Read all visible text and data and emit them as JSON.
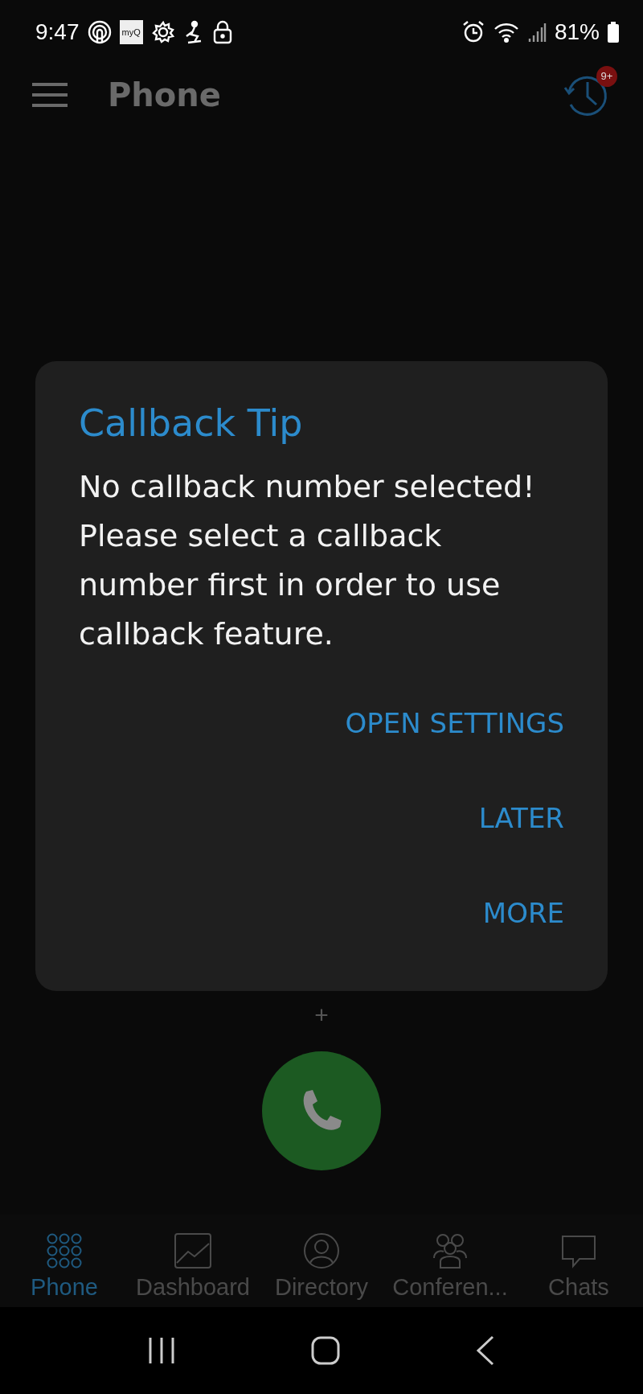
{
  "status_bar": {
    "time": "9:47",
    "app_label": "myQ",
    "battery": "81%"
  },
  "app_bar": {
    "title": "Phone",
    "badge": "9+"
  },
  "dialer": {
    "plus_key": "+"
  },
  "dialog": {
    "title": "Callback Tip",
    "message": "No callback number selected!\nPlease select a callback number first in order to use callback feature.",
    "buttons": [
      "OPEN SETTINGS",
      "LATER",
      "MORE"
    ]
  },
  "tabs": [
    {
      "label": "Phone",
      "kind": "keypad",
      "selected": true
    },
    {
      "label": "Dashboard",
      "kind": "chart",
      "selected": false
    },
    {
      "label": "Directory",
      "kind": "person",
      "selected": false
    },
    {
      "label": "Conferen...",
      "kind": "group",
      "selected": false
    },
    {
      "label": "Chats",
      "kind": "chat",
      "selected": false
    }
  ]
}
